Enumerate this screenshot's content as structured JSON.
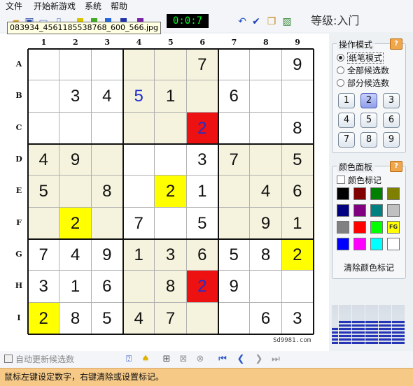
{
  "menu": [
    "文件",
    "开始新游戏",
    "系统",
    "帮助"
  ],
  "toolbar": {
    "timer": "0:0:7",
    "level_label": "等级:入门",
    "tooltip": "083934_4561185538768_600_566.jpg",
    "icons": [
      "open-icon",
      "save-icon",
      "new-icon",
      "print-icon",
      "undo-icon",
      "check-icon",
      "copy-icon",
      "image-icon"
    ],
    "mini_colors": [
      "#d8c400",
      "#44aa22",
      "#2266dd",
      "#2233aa",
      "#7722aa"
    ]
  },
  "board": {
    "col_headers": [
      "1",
      "2",
      "3",
      "4",
      "5",
      "6",
      "7",
      "8",
      "9"
    ],
    "row_headers": [
      "A",
      "B",
      "C",
      "D",
      "E",
      "F",
      "G",
      "H",
      "I"
    ],
    "cells": [
      [
        {
          "v": "",
          "c": "w"
        },
        {
          "v": "",
          "c": "w"
        },
        {
          "v": "",
          "c": "w"
        },
        {
          "v": "",
          "c": "s"
        },
        {
          "v": "",
          "c": "s"
        },
        {
          "v": "7",
          "c": "s"
        },
        {
          "v": "",
          "c": "w"
        },
        {
          "v": "",
          "c": "w"
        },
        {
          "v": "9",
          "c": "w"
        }
      ],
      [
        {
          "v": "",
          "c": "w"
        },
        {
          "v": "3",
          "c": "w"
        },
        {
          "v": "4",
          "c": "w"
        },
        {
          "v": "5",
          "c": "s",
          "t": "b"
        },
        {
          "v": "1",
          "c": "s"
        },
        {
          "v": "",
          "c": "s"
        },
        {
          "v": "6",
          "c": "w"
        },
        {
          "v": "",
          "c": "w"
        },
        {
          "v": "",
          "c": "w"
        }
      ],
      [
        {
          "v": "",
          "c": "w"
        },
        {
          "v": "",
          "c": "w"
        },
        {
          "v": "",
          "c": "w"
        },
        {
          "v": "",
          "c": "s"
        },
        {
          "v": "",
          "c": "s"
        },
        {
          "v": "2",
          "c": "r"
        },
        {
          "v": "",
          "c": "w"
        },
        {
          "v": "",
          "c": "w"
        },
        {
          "v": "8",
          "c": "w"
        }
      ],
      [
        {
          "v": "4",
          "c": "s"
        },
        {
          "v": "9",
          "c": "s"
        },
        {
          "v": "",
          "c": "s"
        },
        {
          "v": "",
          "c": "w"
        },
        {
          "v": "",
          "c": "w"
        },
        {
          "v": "3",
          "c": "w"
        },
        {
          "v": "7",
          "c": "s"
        },
        {
          "v": "",
          "c": "s"
        },
        {
          "v": "5",
          "c": "s"
        }
      ],
      [
        {
          "v": "5",
          "c": "s"
        },
        {
          "v": "",
          "c": "s"
        },
        {
          "v": "8",
          "c": "s"
        },
        {
          "v": "",
          "c": "w"
        },
        {
          "v": "2",
          "c": "y"
        },
        {
          "v": "1",
          "c": "w"
        },
        {
          "v": "",
          "c": "s"
        },
        {
          "v": "4",
          "c": "s"
        },
        {
          "v": "6",
          "c": "s"
        }
      ],
      [
        {
          "v": "",
          "c": "s"
        },
        {
          "v": "2",
          "c": "y"
        },
        {
          "v": "",
          "c": "s"
        },
        {
          "v": "7",
          "c": "w"
        },
        {
          "v": "",
          "c": "w"
        },
        {
          "v": "5",
          "c": "w"
        },
        {
          "v": "",
          "c": "s"
        },
        {
          "v": "9",
          "c": "s"
        },
        {
          "v": "1",
          "c": "s"
        }
      ],
      [
        {
          "v": "7",
          "c": "w"
        },
        {
          "v": "4",
          "c": "w"
        },
        {
          "v": "9",
          "c": "w"
        },
        {
          "v": "1",
          "c": "s"
        },
        {
          "v": "3",
          "c": "s"
        },
        {
          "v": "6",
          "c": "s"
        },
        {
          "v": "5",
          "c": "w"
        },
        {
          "v": "8",
          "c": "w"
        },
        {
          "v": "2",
          "c": "y"
        }
      ],
      [
        {
          "v": "3",
          "c": "w"
        },
        {
          "v": "1",
          "c": "w"
        },
        {
          "v": "6",
          "c": "w"
        },
        {
          "v": "",
          "c": "s"
        },
        {
          "v": "8",
          "c": "s"
        },
        {
          "v": "2",
          "c": "r"
        },
        {
          "v": "9",
          "c": "w"
        },
        {
          "v": "",
          "c": "w"
        },
        {
          "v": "",
          "c": "w"
        }
      ],
      [
        {
          "v": "2",
          "c": "y"
        },
        {
          "v": "8",
          "c": "w"
        },
        {
          "v": "5",
          "c": "w"
        },
        {
          "v": "4",
          "c": "s"
        },
        {
          "v": "7",
          "c": "s"
        },
        {
          "v": "",
          "c": "s"
        },
        {
          "v": "",
          "c": "w"
        },
        {
          "v": "6",
          "c": "w"
        },
        {
          "v": "3",
          "c": "w"
        }
      ]
    ],
    "watermark": "Sd9981.com"
  },
  "mode_panel": {
    "title": "操作模式",
    "help": "?",
    "options": [
      {
        "label": "纸笔模式",
        "selected": true
      },
      {
        "label": "全部候选数",
        "selected": false
      },
      {
        "label": "部分候选数",
        "selected": false
      }
    ],
    "numbers": [
      "1",
      "2",
      "3",
      "4",
      "5",
      "6",
      "7",
      "8",
      "9"
    ],
    "selected_number": "2"
  },
  "color_panel": {
    "title": "颜色面板",
    "help": "?",
    "checkbox_label": "颜色标记",
    "colors": [
      "#000000",
      "#800000",
      "#008000",
      "#808000",
      "#000080",
      "#800080",
      "#008080",
      "#c0c0c0",
      "#808080",
      "#ff0000",
      "#00ff00",
      "#ffff00",
      "#0000ff",
      "#ff00ff",
      "#00ffff",
      "#ffffff"
    ],
    "fg_label": "FG",
    "clear_label": "清除颜色标记"
  },
  "meter_levels": [
    0.45,
    0.62,
    0.62,
    0.62,
    0.62,
    0.62,
    0.62,
    0.62,
    0.62,
    0.62,
    0.62
  ],
  "bottom": {
    "auto_update_label": "自动更新候选数",
    "icons": [
      "hint-icon",
      "bell-icon",
      "rule-icon",
      "rule-icon-2",
      "rule-icon-3",
      "first-icon",
      "prev-icon",
      "next-icon",
      "last-icon"
    ]
  },
  "status": "鼠标左键设定数字，右键清除或设置标记。"
}
